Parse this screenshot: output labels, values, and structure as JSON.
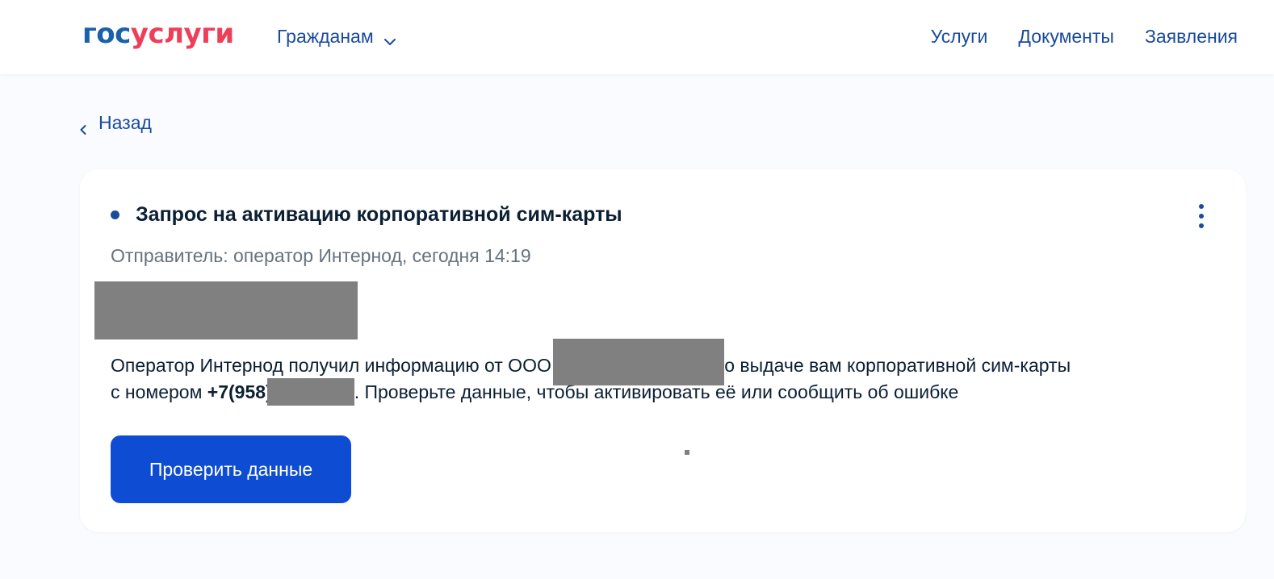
{
  "header": {
    "logo": {
      "part1": "гос",
      "part2": "услуги"
    },
    "citizens_menu_label": "Гражданам",
    "nav": [
      {
        "label": "Услуги"
      },
      {
        "label": "Документы"
      },
      {
        "label": "Заявления"
      }
    ]
  },
  "back_label": "Назад",
  "message": {
    "title": "Запрос на активацию корпоративной сим-карты",
    "sender": "Отправитель: оператор Интернод, сегодня 14:19",
    "body_line1_before": "Оператор Интернод получил информацию от ООО ",
    "body_line1_after": "о выдаче вам корпоративной сим-карты",
    "body_line2_before": "с номером ",
    "phone_prefix": "+7(958)",
    "body_line2_after": ". Проверьте данные, чтобы активировать её или сообщить об ошибке",
    "action_label": "Проверить данные"
  },
  "colors": {
    "brand_blue": "#0d4cd3",
    "brand_red": "#ee3f58",
    "link_blue": "#1a4b9b",
    "background": "#f9fbfe",
    "redaction_gray": "#808080"
  },
  "icons": {
    "chevron_down": "chevron-down-icon",
    "chevron_left": "chevron-left-icon",
    "kebab": "more-vertical-icon",
    "unread_dot": "unread-dot-icon"
  }
}
